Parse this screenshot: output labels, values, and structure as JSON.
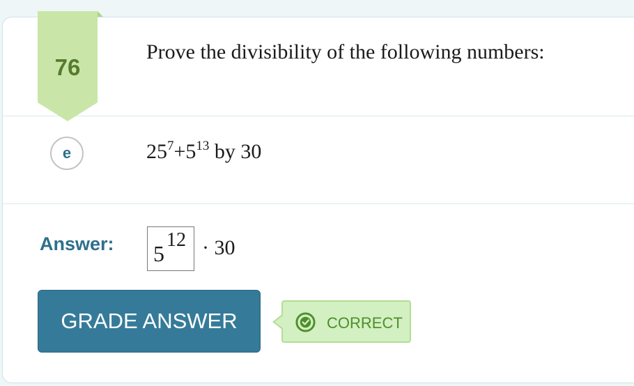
{
  "problem": {
    "number": "76",
    "prompt": "Prove the divisibility of the following numbers:"
  },
  "part": {
    "label": "e",
    "expression": {
      "base1": "25",
      "exp1": "7",
      "operator": "+",
      "base2": "5",
      "exp2": "13",
      "suffix": " by 30"
    }
  },
  "answer": {
    "label": "Answer:",
    "input_base": "5",
    "input_exponent": "12",
    "rest": "· 30"
  },
  "grade_button": {
    "label": "GRADE ANSWER"
  },
  "feedback": {
    "status": "CORRECT",
    "icon": "check-circle-icon"
  },
  "colors": {
    "accent": "#357b99",
    "badge_green": "#c9e6a8",
    "correct_green": "#4f8e2c",
    "correct_bg": "#d2f0c1"
  }
}
